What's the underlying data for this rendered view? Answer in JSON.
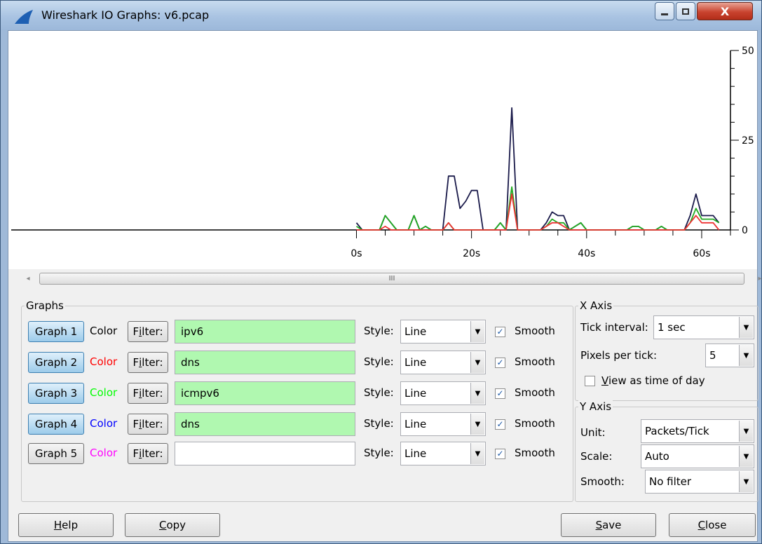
{
  "window": {
    "title": "Wireshark IO Graphs: v6.pcap",
    "min_label": "—",
    "max_label": "□",
    "close_label": "X"
  },
  "chart_data": {
    "type": "line",
    "x_ticks": [
      "0s",
      "20s",
      "40s",
      "60s"
    ],
    "x_tick_values": [
      0,
      20,
      40,
      60
    ],
    "y_ticks": [
      "50",
      "25",
      "0"
    ],
    "y_tick_values": [
      50,
      25,
      0
    ],
    "xlim": [
      -60,
      65
    ],
    "ylim": [
      0,
      50
    ],
    "series": [
      {
        "color": "#1a1a4a",
        "points": [
          [
            0,
            2
          ],
          [
            1,
            0
          ],
          [
            2,
            0
          ],
          [
            3,
            0
          ],
          [
            4,
            0
          ],
          [
            5,
            4
          ],
          [
            6,
            2
          ],
          [
            7,
            0
          ],
          [
            8,
            0
          ],
          [
            9,
            0
          ],
          [
            10,
            4
          ],
          [
            11,
            0
          ],
          [
            12,
            1
          ],
          [
            13,
            0
          ],
          [
            14,
            0
          ],
          [
            15,
            0
          ],
          [
            16,
            15
          ],
          [
            17,
            15
          ],
          [
            18,
            6
          ],
          [
            19,
            8
          ],
          [
            20,
            11
          ],
          [
            21,
            11
          ],
          [
            22,
            0
          ],
          [
            23,
            0
          ],
          [
            24,
            0
          ],
          [
            25,
            2
          ],
          [
            26,
            0
          ],
          [
            27,
            34
          ],
          [
            28,
            0
          ],
          [
            29,
            0
          ],
          [
            30,
            0
          ],
          [
            31,
            0
          ],
          [
            32,
            0
          ],
          [
            33,
            2
          ],
          [
            34,
            5
          ],
          [
            35,
            4
          ],
          [
            36,
            4
          ],
          [
            37,
            0
          ],
          [
            38,
            1
          ],
          [
            39,
            2
          ],
          [
            40,
            0
          ],
          [
            41,
            0
          ],
          [
            42,
            0
          ],
          [
            43,
            0
          ],
          [
            44,
            0
          ],
          [
            45,
            0
          ],
          [
            46,
            0
          ],
          [
            47,
            0
          ],
          [
            48,
            1
          ],
          [
            49,
            1
          ],
          [
            50,
            0
          ],
          [
            51,
            0
          ],
          [
            52,
            0
          ],
          [
            53,
            1
          ],
          [
            54,
            0
          ],
          [
            55,
            0
          ],
          [
            56,
            0
          ],
          [
            57,
            0
          ],
          [
            58,
            4
          ],
          [
            59,
            10
          ],
          [
            60,
            4
          ],
          [
            61,
            4
          ],
          [
            62,
            4
          ],
          [
            63,
            2
          ]
        ]
      },
      {
        "color": "#22aa22",
        "points": [
          [
            0,
            1
          ],
          [
            1,
            0
          ],
          [
            2,
            0
          ],
          [
            3,
            0
          ],
          [
            4,
            0
          ],
          [
            5,
            4
          ],
          [
            6,
            2
          ],
          [
            7,
            0
          ],
          [
            8,
            0
          ],
          [
            9,
            0
          ],
          [
            10,
            4
          ],
          [
            11,
            0
          ],
          [
            12,
            1
          ],
          [
            13,
            0
          ],
          [
            14,
            0
          ],
          [
            15,
            0
          ],
          [
            16,
            2
          ],
          [
            17,
            0
          ],
          [
            18,
            0
          ],
          [
            19,
            0
          ],
          [
            20,
            0
          ],
          [
            21,
            0
          ],
          [
            22,
            0
          ],
          [
            23,
            0
          ],
          [
            24,
            0
          ],
          [
            25,
            2
          ],
          [
            26,
            0
          ],
          [
            27,
            12
          ],
          [
            28,
            0
          ],
          [
            29,
            0
          ],
          [
            30,
            0
          ],
          [
            31,
            0
          ],
          [
            32,
            0
          ],
          [
            33,
            1
          ],
          [
            34,
            3
          ],
          [
            35,
            2
          ],
          [
            36,
            2
          ],
          [
            37,
            0
          ],
          [
            38,
            1
          ],
          [
            39,
            2
          ],
          [
            40,
            0
          ],
          [
            41,
            0
          ],
          [
            42,
            0
          ],
          [
            43,
            0
          ],
          [
            44,
            0
          ],
          [
            45,
            0
          ],
          [
            46,
            0
          ],
          [
            47,
            0
          ],
          [
            48,
            1
          ],
          [
            49,
            1
          ],
          [
            50,
            0
          ],
          [
            51,
            0
          ],
          [
            52,
            0
          ],
          [
            53,
            1
          ],
          [
            54,
            0
          ],
          [
            55,
            0
          ],
          [
            56,
            0
          ],
          [
            57,
            0
          ],
          [
            58,
            2
          ],
          [
            59,
            6
          ],
          [
            60,
            3
          ],
          [
            61,
            3
          ],
          [
            62,
            3
          ],
          [
            63,
            2
          ]
        ]
      },
      {
        "color": "#ee3333",
        "points": [
          [
            0,
            0
          ],
          [
            1,
            0
          ],
          [
            2,
            0
          ],
          [
            3,
            0
          ],
          [
            4,
            0
          ],
          [
            5,
            1
          ],
          [
            6,
            0
          ],
          [
            7,
            0
          ],
          [
            8,
            0
          ],
          [
            9,
            0
          ],
          [
            10,
            0
          ],
          [
            11,
            0
          ],
          [
            12,
            0
          ],
          [
            13,
            0
          ],
          [
            14,
            0
          ],
          [
            15,
            0
          ],
          [
            16,
            2
          ],
          [
            17,
            0
          ],
          [
            18,
            0
          ],
          [
            19,
            0
          ],
          [
            20,
            0
          ],
          [
            21,
            0
          ],
          [
            22,
            0
          ],
          [
            23,
            0
          ],
          [
            24,
            0
          ],
          [
            25,
            0
          ],
          [
            26,
            0
          ],
          [
            27,
            10
          ],
          [
            28,
            0
          ],
          [
            29,
            0
          ],
          [
            30,
            0
          ],
          [
            31,
            0
          ],
          [
            32,
            0
          ],
          [
            33,
            1
          ],
          [
            34,
            2
          ],
          [
            35,
            2
          ],
          [
            36,
            1
          ],
          [
            37,
            0
          ],
          [
            38,
            0
          ],
          [
            39,
            0
          ],
          [
            40,
            0
          ],
          [
            41,
            0
          ],
          [
            42,
            0
          ],
          [
            43,
            0
          ],
          [
            44,
            0
          ],
          [
            45,
            0
          ],
          [
            46,
            0
          ],
          [
            47,
            0
          ],
          [
            48,
            0
          ],
          [
            49,
            0
          ],
          [
            50,
            0
          ],
          [
            51,
            0
          ],
          [
            52,
            0
          ],
          [
            53,
            0
          ],
          [
            54,
            0
          ],
          [
            55,
            0
          ],
          [
            56,
            0
          ],
          [
            57,
            0
          ],
          [
            58,
            2
          ],
          [
            59,
            4
          ],
          [
            60,
            2
          ],
          [
            61,
            2
          ],
          [
            62,
            2
          ],
          [
            63,
            0
          ]
        ]
      }
    ]
  },
  "scrollbar": {
    "left_arrow": "◂",
    "right_arrow": "▸",
    "grip": "III"
  },
  "graphs_panel": {
    "title": "Graphs",
    "color_label": "Color",
    "filter_label_pre": "F",
    "filter_label_acc": "i",
    "filter_label_post": "lter:",
    "style_label": "Style:",
    "smooth_label": "Smooth",
    "rows": [
      {
        "button": "Graph 1",
        "color": "#000000",
        "filter": "ipv6",
        "style": "Line",
        "smooth": "✓"
      },
      {
        "button": "Graph 2",
        "color": "#ff0000",
        "filter": "dns",
        "style": "Line",
        "smooth": "✓"
      },
      {
        "button": "Graph 3",
        "color": "#00ff00",
        "filter": "icmpv6",
        "style": "Line",
        "smooth": "✓"
      },
      {
        "button": "Graph 4",
        "color": "#0000ff",
        "filter": "dns",
        "style": "Line",
        "smooth": "✓"
      },
      {
        "button": "Graph 5",
        "color": "#ff00ff",
        "filter": "",
        "style": "Line",
        "smooth": "✓"
      }
    ]
  },
  "x_axis": {
    "title": "X Axis",
    "tick_interval_label": "Tick interval:",
    "tick_interval_value": "1 sec",
    "pixels_per_tick_label": "Pixels per tick:",
    "pixels_per_tick_value": "5",
    "view_tod_acc": "V",
    "view_tod_rest": "iew as time of day"
  },
  "y_axis": {
    "title": "Y Axis",
    "unit_label": "Unit:",
    "unit_value": "Packets/Tick",
    "scale_label": "Scale:",
    "scale_value": "Auto",
    "smooth_label": "Smooth:",
    "smooth_value": "No filter"
  },
  "buttons": {
    "help_acc": "H",
    "help_rest": "elp",
    "copy_acc": "C",
    "copy_rest": "opy",
    "save_acc": "S",
    "save_rest": "ave",
    "close_acc": "C",
    "close_rest": "lose"
  },
  "dropdown_glyph": "▼"
}
